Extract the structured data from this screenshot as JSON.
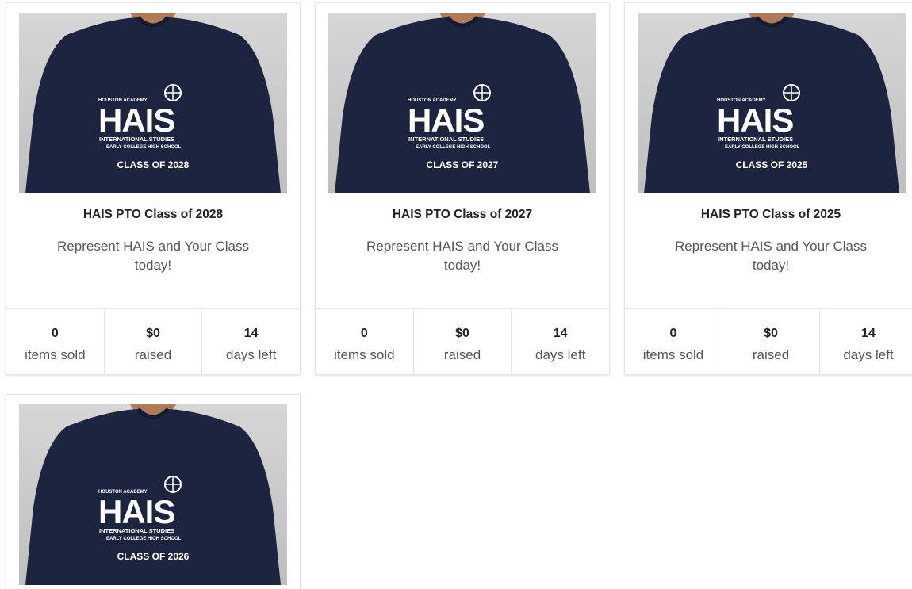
{
  "campaigns": [
    {
      "title": "HAIS PTO Class of 2028",
      "description": "Represent HAIS and Your Class today!",
      "shirt": {
        "top": "HOUSTON ACADEMY",
        "logo": "HAIS",
        "line1": "INTERNATIONAL STUDIES",
        "line2": "EARLY COLLEGE HIGH SCHOOL",
        "class": "CLASS OF 2028"
      },
      "stats": {
        "items_sold": "0",
        "items_sold_label": "items sold",
        "raised": "$0",
        "raised_label": "raised",
        "days_left": "14",
        "days_left_label": "days left"
      }
    },
    {
      "title": "HAIS PTO Class of 2027",
      "description": "Represent HAIS and Your Class today!",
      "shirt": {
        "top": "HOUSTON ACADEMY",
        "logo": "HAIS",
        "line1": "INTERNATIONAL STUDIES",
        "line2": "EARLY COLLEGE HIGH SCHOOL",
        "class": "CLASS OF 2027"
      },
      "stats": {
        "items_sold": "0",
        "items_sold_label": "items sold",
        "raised": "$0",
        "raised_label": "raised",
        "days_left": "14",
        "days_left_label": "days left"
      }
    },
    {
      "title": "HAIS PTO Class of 2025",
      "description": "Represent HAIS and Your Class today!",
      "shirt": {
        "top": "HOUSTON ACADEMY",
        "logo": "HAIS",
        "line1": "INTERNATIONAL STUDIES",
        "line2": "EARLY COLLEGE HIGH SCHOOL",
        "class": "CLASS OF 2025"
      },
      "stats": {
        "items_sold": "0",
        "items_sold_label": "items sold",
        "raised": "$0",
        "raised_label": "raised",
        "days_left": "14",
        "days_left_label": "days left"
      }
    },
    {
      "shirt": {
        "top": "HOUSTON ACADEMY",
        "logo": "HAIS",
        "line1": "INTERNATIONAL STUDIES",
        "line2": "EARLY COLLEGE HIGH SCHOOL",
        "class": "CLASS OF 2026"
      }
    }
  ],
  "colors": {
    "shirt": "#1c2440",
    "print": "#ffffff",
    "background": "#cfcfcf",
    "skin": "#b07a58"
  }
}
